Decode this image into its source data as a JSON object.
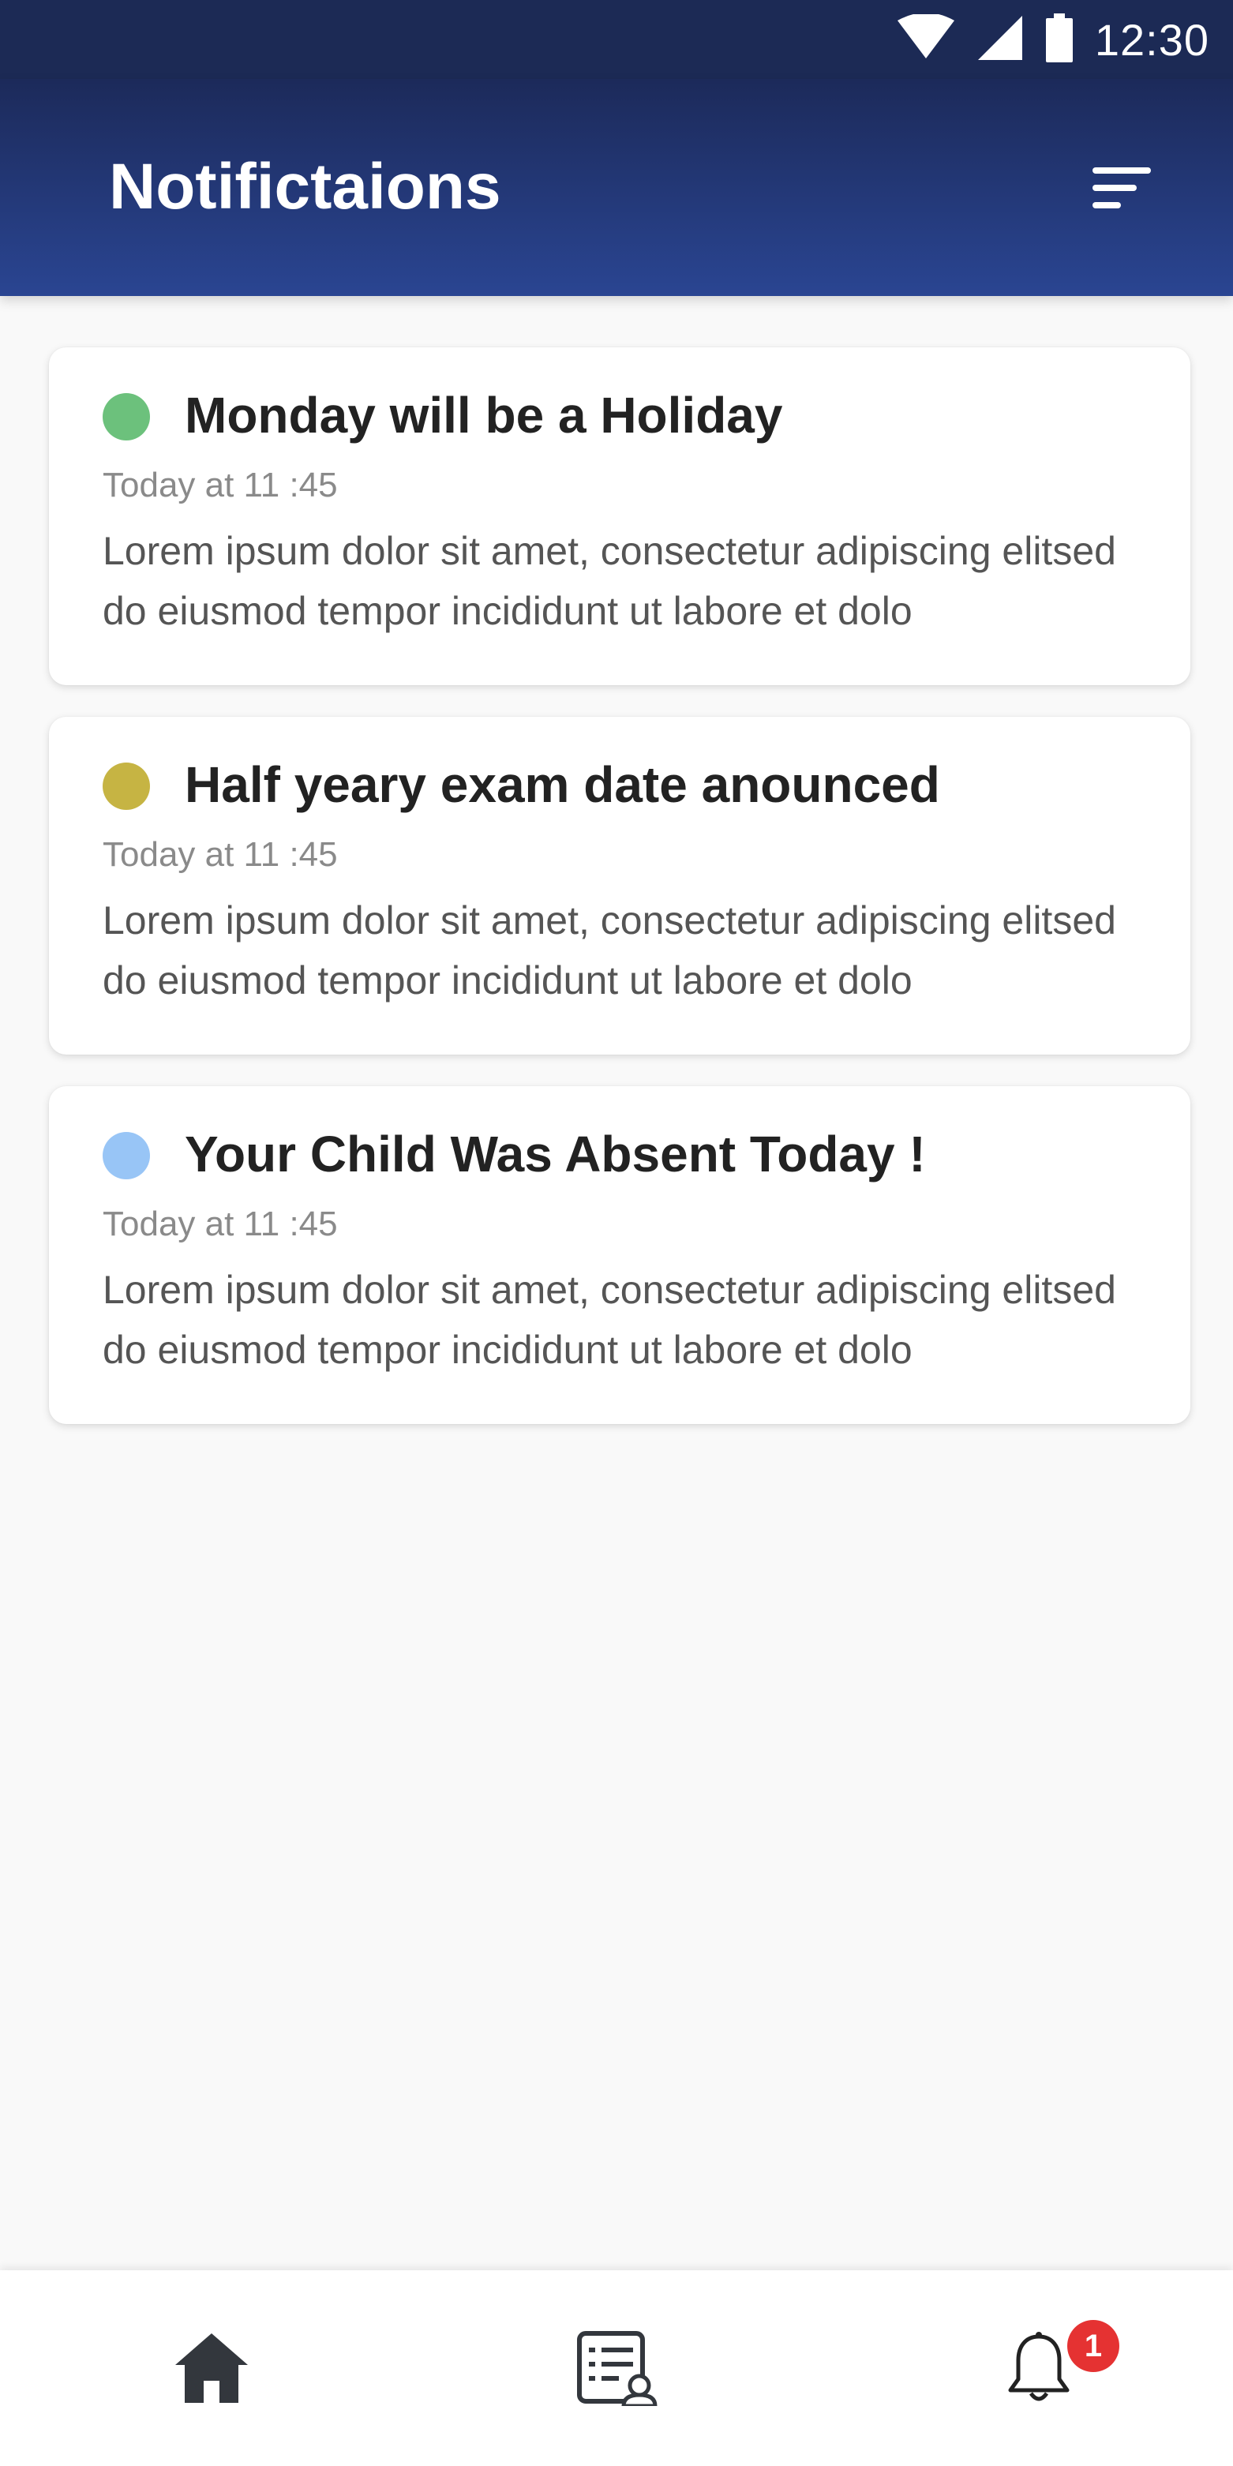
{
  "status_bar": {
    "time": "12:30",
    "icons": [
      "wifi-icon",
      "signal-icon",
      "battery-icon"
    ]
  },
  "header": {
    "title": "Notifictaions",
    "filter_icon": "filter-icon"
  },
  "notifications": [
    {
      "title": "Monday will be a Holiday",
      "time": "Today at 11 :45",
      "body": "Lorem ipsum dolor sit amet, consectetur adipiscing elitsed do eiusmod tempor incididunt ut labore et dolo",
      "dot_color": "#6cc17c"
    },
    {
      "title": "Half yeary exam date anounced",
      "time": "Today at 11 :45",
      "body": "Lorem ipsum dolor sit amet, consectetur adipiscing elitsed do eiusmod tempor incididunt ut labore et dolo",
      "dot_color": "#c6b443"
    },
    {
      "title": "Your Child Was Absent Today !",
      "time": "Today at 11 :45",
      "body": "Lorem ipsum dolor sit amet, consectetur adipiscing elitsed do eiusmod tempor incididunt ut labore et dolo",
      "dot_color": "#98c5f6"
    }
  ],
  "bottom_nav": {
    "items": [
      "home-icon",
      "student-list-icon",
      "bell-icon"
    ],
    "badge_count": "1"
  },
  "colors": {
    "header_top": "#1c2a5a",
    "header_bottom": "#2a4592",
    "badge": "#e53232"
  }
}
